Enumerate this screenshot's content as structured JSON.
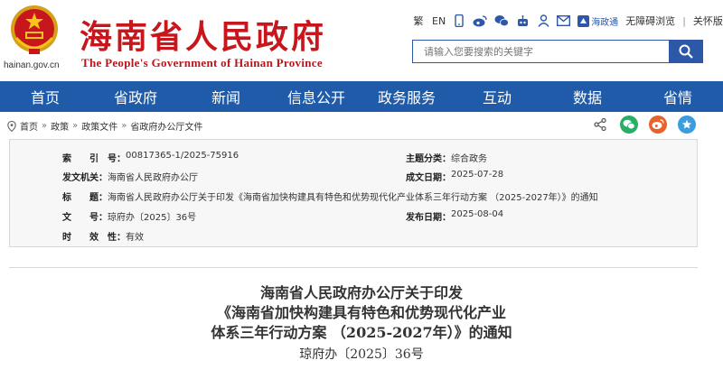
{
  "header": {
    "domain": "hainan.gov.cn",
    "title_cn": "海南省人民政府",
    "title_en": "The People's Government of Hainan Province",
    "tools": {
      "traditional": "繁",
      "english": "EN",
      "hainantong": "海政通",
      "accessible": "无障碍浏览",
      "separator": "|",
      "care": "关怀版"
    },
    "search_placeholder": "请输入您要搜索的关键字"
  },
  "nav": {
    "items": [
      "首页",
      "省政府",
      "新闻",
      "信息公开",
      "政务服务",
      "互动",
      "数据",
      "省情"
    ]
  },
  "breadcrumb": {
    "items": [
      "首页",
      "政策",
      "政策文件",
      "省政府办公厅文件"
    ],
    "separator": "»"
  },
  "meta": {
    "index_label": "索　　引　号：",
    "index_value": "00817365-1/2025-75916",
    "topic_label": "主题分类：",
    "topic_value": "综合政务",
    "issuer_label": "发文机关：",
    "issuer_value": "海南省人民政府办公厅",
    "date_label": "成文日期：",
    "date_value": "2025-07-28",
    "title_label": "标　　题：",
    "title_value": "海南省人民政府办公厅关于印发《海南省加快构建具有特色和优势现代化产业体系三年行动方案 （2025-2027年）》的通知",
    "docno_label": "文　　号：",
    "docno_value": "琼府办〔2025〕36号",
    "publish_label": "发布日期：",
    "publish_value": "2025-08-04",
    "validity_label": "时　　效　性：",
    "validity_value": "有效"
  },
  "document": {
    "title_line1": "海南省人民政府办公厅关于印发",
    "title_line2": "《海南省加快构建具有特色和优势现代化产业",
    "title_line3": "体系三年行动方案 （2025-2027年）》的通知",
    "doc_number": "琼府办〔2025〕36号"
  },
  "colors": {
    "brand_red": "#c8161d",
    "nav_blue": "#1f5ba8",
    "link_blue": "#2d58a8",
    "wechat_green": "#2aae67",
    "weibo_orange": "#e8632b",
    "star_blue": "#3b9de0"
  }
}
